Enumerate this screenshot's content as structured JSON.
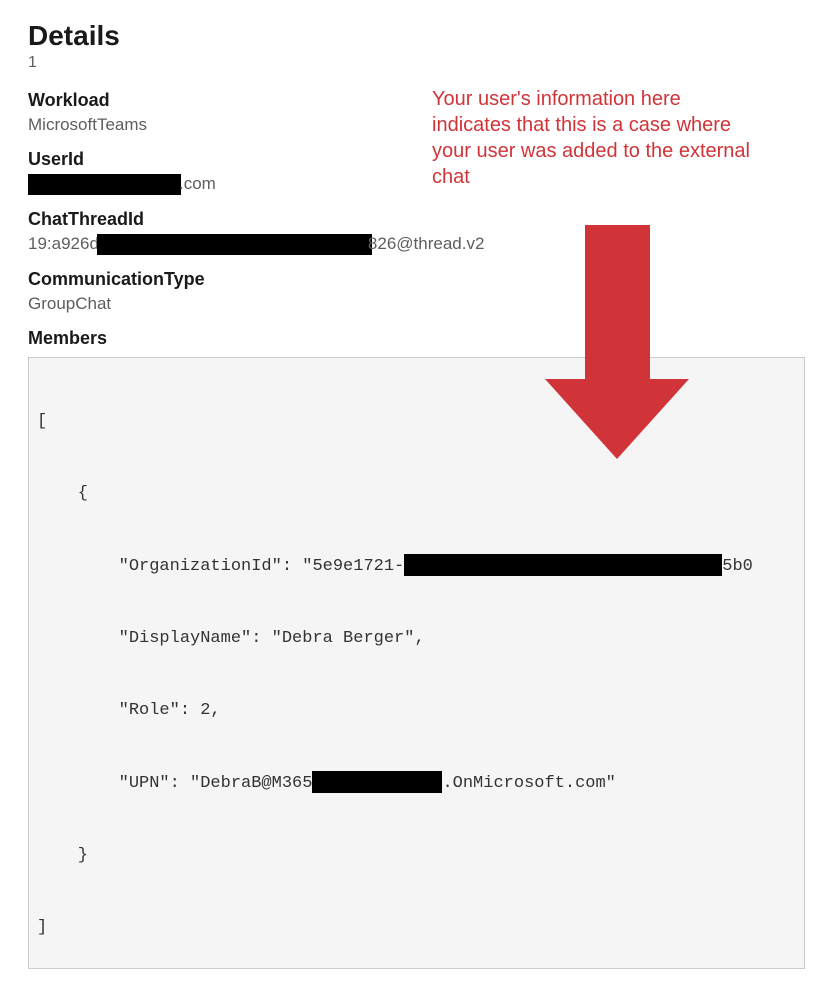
{
  "header": {
    "title": "Details",
    "count": "1"
  },
  "fields": {
    "workload": {
      "label": "Workload",
      "value": "MicrosoftTeams"
    },
    "userId": {
      "label": "UserId",
      "suffix": ".com"
    },
    "chatThreadId": {
      "label": "ChatThreadId",
      "prefix": "19:a926d",
      "suffix": "826@thread.v2"
    },
    "communicationType": {
      "label": "CommunicationType",
      "value": "GroupChat"
    },
    "members": {
      "label": "Members"
    }
  },
  "annotation": {
    "text": "Your user's information here indicates that this is a case where your user was added to the external chat"
  },
  "membersCode": {
    "line1": "[",
    "line2": "    {",
    "line3a": "        \"OrganizationId\": \"5e9e1721-",
    "line3b": "5b0",
    "line4": "        \"DisplayName\": \"Debra Berger\",",
    "line5": "        \"Role\": 2,",
    "line6a": "        \"UPN\": \"DebraB@M365",
    "line6b": ".OnMicrosoft.com\"",
    "line7": "    }",
    "line8": "]"
  }
}
